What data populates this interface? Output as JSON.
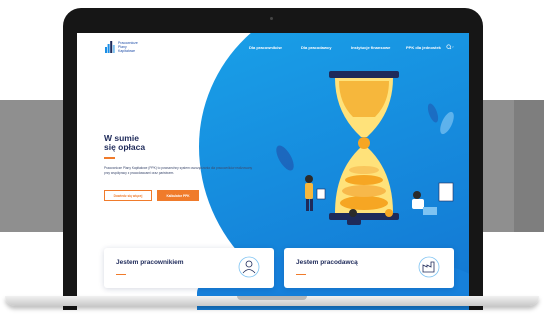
{
  "logo": {
    "line1": "Pracownicze",
    "line2": "Plany",
    "line3": "Kapitałowe"
  },
  "nav": {
    "items": [
      {
        "label": "Dla pracowników"
      },
      {
        "label": "Dla pracodawcy"
      },
      {
        "label": "Instytucje finansowe"
      },
      {
        "label": "PPK dla jednostek"
      }
    ]
  },
  "hero": {
    "title_line1": "W sumie",
    "title_line2": "się opłaca",
    "description": "Pracownicze Plany Kapitałowe (PPK) to powszechny system oszczędzania dla pracowników realizowany przy współpracy z pracodawcami oraz państwem.",
    "btn_secondary": "Dowiedz się więcej",
    "btn_primary": "Kalkulator PPK"
  },
  "cards": [
    {
      "title": "Jestem pracownikiem",
      "icon": "worker-icon"
    },
    {
      "title": "Jestem pracodawcą",
      "icon": "factory-icon"
    }
  ],
  "colors": {
    "accent": "#f07b2b",
    "brand_blue": "#1a8ee6",
    "navy": "#1e2a5a"
  }
}
